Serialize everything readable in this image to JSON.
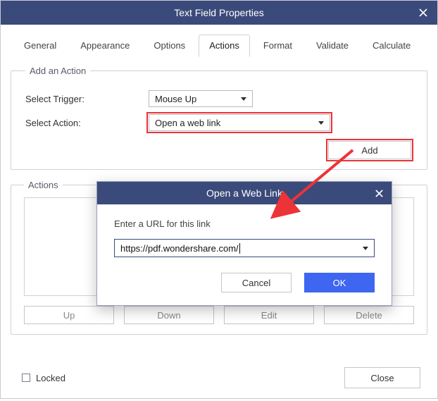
{
  "window": {
    "title": "Text Field Properties"
  },
  "tabs": [
    {
      "label": "General",
      "active": false
    },
    {
      "label": "Appearance",
      "active": false
    },
    {
      "label": "Options",
      "active": false
    },
    {
      "label": "Actions",
      "active": true
    },
    {
      "label": "Format",
      "active": false
    },
    {
      "label": "Validate",
      "active": false
    },
    {
      "label": "Calculate",
      "active": false
    }
  ],
  "addAction": {
    "legend": "Add an Action",
    "triggerLabel": "Select Trigger:",
    "triggerValue": "Mouse Up",
    "actionLabel": "Select Action:",
    "actionValue": "Open a web link",
    "addButton": "Add"
  },
  "actions": {
    "legend": "Actions",
    "buttons": {
      "up": "Up",
      "down": "Down",
      "edit": "Edit",
      "delete": "Delete"
    }
  },
  "footer": {
    "locked": "Locked",
    "close": "Close"
  },
  "modal": {
    "title": "Open a Web Link",
    "prompt": "Enter a URL for this link",
    "url": "https://pdf.wondershare.com/",
    "cancel": "Cancel",
    "ok": "OK"
  }
}
